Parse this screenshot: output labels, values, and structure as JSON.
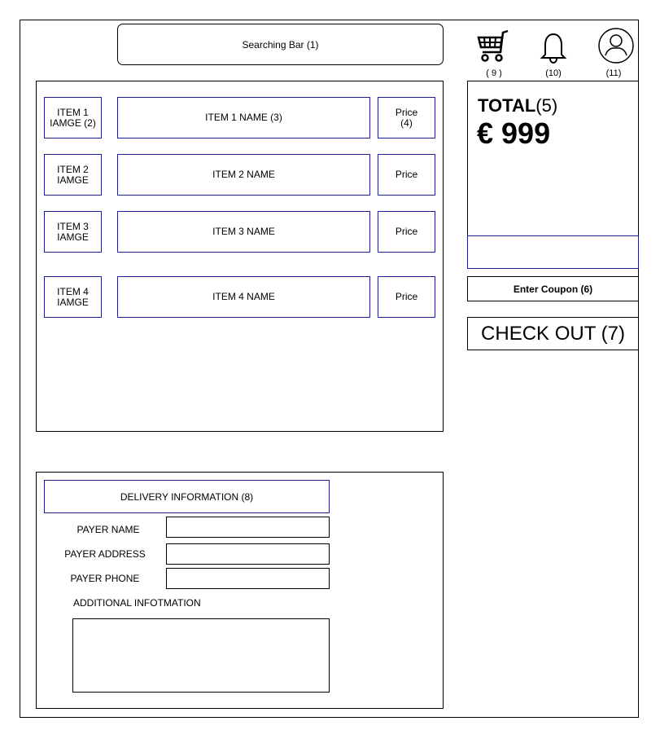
{
  "search": {
    "label": "Searching Bar (1)"
  },
  "header_icons": [
    {
      "icon": "shopping-cart-icon",
      "label": "( 9 )"
    },
    {
      "icon": "bell-icon",
      "label": "(10)"
    },
    {
      "icon": "user-icon",
      "label": "(11)"
    }
  ],
  "items": [
    {
      "image": "ITEM 1\nIAMGE (2)",
      "name": "ITEM 1 NAME (3)",
      "price": "Price\n(4)"
    },
    {
      "image": "ITEM 2\nIAMGE",
      "name": "ITEM 2 NAME",
      "price": "Price"
    },
    {
      "image": "ITEM 3\nIAMGE",
      "name": "ITEM 3 NAME",
      "price": "Price"
    },
    {
      "image": "ITEM 4\nIAMGE",
      "name": "ITEM 4 NAME",
      "price": "Price"
    }
  ],
  "total": {
    "title": "TOTAL",
    "title_suffix": "(5)",
    "amount": "€ 999"
  },
  "coupon": {
    "label": "Enter Coupon (6)"
  },
  "checkout": {
    "label": "CHECK OUT (7)"
  },
  "delivery": {
    "title": "DELIVERY INFORMATION (8)",
    "fields": [
      {
        "label": "PAYER NAME",
        "value": ""
      },
      {
        "label": "PAYER ADDRESS",
        "value": ""
      },
      {
        "label": "PAYER PHONE",
        "value": ""
      }
    ],
    "additional_label": "ADDITIONAL INFOTMATION",
    "additional_value": ""
  },
  "colors": {
    "accent_border": "#1f1f8f",
    "border": "#000000",
    "background": "#ffffff"
  }
}
